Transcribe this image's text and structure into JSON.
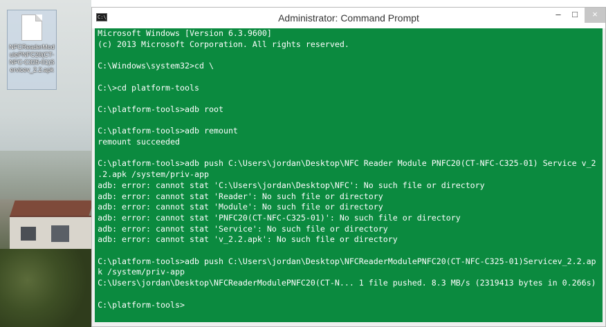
{
  "desktop": {
    "icon_label": "NFCReaderModulePNFC20(CT-NFC-C325-01)Servicev_2.2.apk"
  },
  "window": {
    "title": "Administrator: Command Prompt",
    "title_icon_text": "C:\\",
    "controls": {
      "minimize": "–",
      "maximize": "□",
      "close": "×"
    }
  },
  "console": {
    "lines": [
      "Microsoft Windows [Version 6.3.9600]",
      "(c) 2013 Microsoft Corporation. All rights reserved.",
      "",
      "C:\\Windows\\system32>cd \\",
      "",
      "C:\\>cd platform-tools",
      "",
      "C:\\platform-tools>adb root",
      "",
      "C:\\platform-tools>adb remount",
      "remount succeeded",
      "",
      "C:\\platform-tools>adb push C:\\Users\\jordan\\Desktop\\NFC Reader Module PNFC20(CT-NFC-C325-01) Service v_2",
      ".2.apk /system/priv-app",
      "adb: error: cannot stat 'C:\\Users\\jordan\\Desktop\\NFC': No such file or directory",
      "adb: error: cannot stat 'Reader': No such file or directory",
      "adb: error: cannot stat 'Module': No such file or directory",
      "adb: error: cannot stat 'PNFC20(CT-NFC-C325-01)': No such file or directory",
      "adb: error: cannot stat 'Service': No such file or directory",
      "adb: error: cannot stat 'v_2.2.apk': No such file or directory",
      "",
      "C:\\platform-tools>adb push C:\\Users\\jordan\\Desktop\\NFCReaderModulePNFC20(CT-NFC-C325-01)Servicev_2.2.ap",
      "k /system/priv-app",
      "C:\\Users\\jordan\\Desktop\\NFCReaderModulePNFC20(CT-N... 1 file pushed. 8.3 MB/s (2319413 bytes in 0.266s)",
      "",
      "C:\\platform-tools>"
    ]
  },
  "colors": {
    "console_background": "#0b8a3f",
    "console_text": "#ffffff"
  }
}
